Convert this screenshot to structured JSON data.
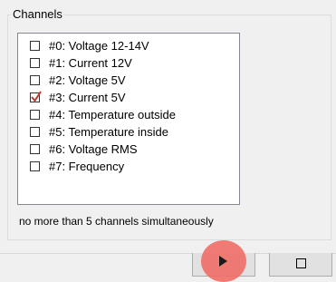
{
  "group": {
    "title": "Channels"
  },
  "channels": [
    {
      "label": "#0: Voltage 12-14V",
      "checked": false
    },
    {
      "label": "#1: Current 12V",
      "checked": false
    },
    {
      "label": "#2: Voltage 5V",
      "checked": false
    },
    {
      "label": "#3: Current 5V",
      "checked": true
    },
    {
      "label": "#4: Temperature outside",
      "checked": false
    },
    {
      "label": "#5: Temperature inside",
      "checked": false
    },
    {
      "label": "#6: Voltage RMS",
      "checked": false
    },
    {
      "label": "#7: Frequency",
      "checked": false
    }
  ],
  "hint": "no more than 5 channels simultaneously",
  "toolbar": {
    "play_icon": "play-icon",
    "stop_icon": "stop-icon"
  },
  "colors": {
    "check_mark": "#c0392b",
    "highlight": "#ee6e66"
  }
}
